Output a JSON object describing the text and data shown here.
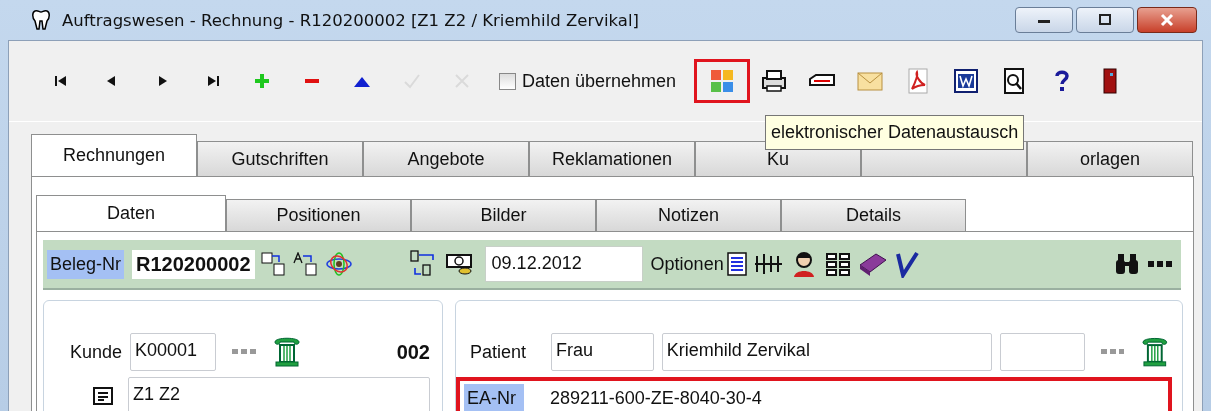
{
  "window": {
    "title": "Auftragswesen - Rechnung - R120200002 [Z1 Z2 / Kriemhild Zervikal]"
  },
  "toolbar": {
    "nav": [
      {
        "kind": "first",
        "disabled": false
      },
      {
        "kind": "prev",
        "disabled": false
      },
      {
        "kind": "next",
        "disabled": false
      },
      {
        "kind": "last",
        "disabled": false
      },
      {
        "kind": "add",
        "disabled": false
      },
      {
        "kind": "remove",
        "disabled": false
      },
      {
        "kind": "up",
        "disabled": false
      },
      {
        "kind": "confirm",
        "disabled": true
      },
      {
        "kind": "cancel",
        "disabled": true
      }
    ],
    "checkbox": {
      "label": "Daten übernehmen",
      "checked": false
    },
    "tools": [
      {
        "kind": "exchange",
        "highlighted": true
      },
      {
        "kind": "print",
        "highlighted": false
      },
      {
        "kind": "card",
        "highlighted": false
      },
      {
        "kind": "mail",
        "highlighted": false
      },
      {
        "kind": "pdf",
        "highlighted": false
      },
      {
        "kind": "word",
        "highlighted": false
      },
      {
        "kind": "preview",
        "highlighted": false
      },
      {
        "kind": "help",
        "highlighted": false
      },
      {
        "kind": "exit",
        "highlighted": false
      }
    ],
    "tooltip": "elektronischer Datenaustausch"
  },
  "tabs": [
    {
      "label": "Rechnungen",
      "selected": true
    },
    {
      "label": "Gutschriften",
      "selected": false
    },
    {
      "label": "Angebote",
      "selected": false
    },
    {
      "label": "Reklamationen",
      "selected": false
    },
    {
      "label": "Ku",
      "selected": false
    },
    {
      "selected": false
    },
    {
      "label": "orlagen",
      "selected": false
    }
  ],
  "subtabs": [
    {
      "label": "Daten",
      "selected": true
    },
    {
      "label": "Positionen",
      "selected": false
    },
    {
      "label": "Bilder",
      "selected": false
    },
    {
      "label": "Notizen",
      "selected": false
    },
    {
      "label": "Details",
      "selected": false
    }
  ],
  "document_bar": {
    "number_label": "Beleg-Nr",
    "number": "R120200002",
    "date": "09.12.2012",
    "options_label": "Optionen"
  },
  "customer": {
    "label": "Kunde",
    "id": "K00001",
    "code": "002",
    "note": "Z1 Z2"
  },
  "patient": {
    "label": "Patient",
    "salutation": "Frau",
    "name": "Kriemhild Zervikal",
    "ea_label": "EA-Nr",
    "ea_number": "289211-600-ZE-8040-30-4",
    "ea_highlighted": true
  }
}
